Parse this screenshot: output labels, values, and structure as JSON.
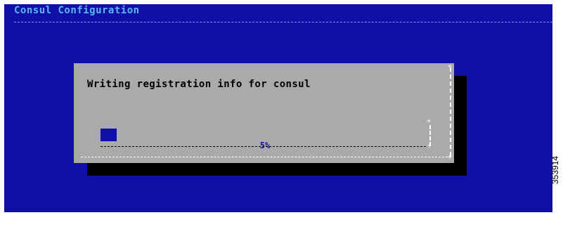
{
  "screen": {
    "title": "Consul Configuration",
    "background_color": "#1010a8",
    "title_color": "#58b8f0"
  },
  "dialog": {
    "message": "Writing registration info for consul",
    "background_color": "#aaaaaa",
    "shadow_color": "#000000",
    "progress": {
      "percent": 5,
      "label": "5%",
      "fill_color": "#1010a8"
    }
  },
  "figure_id": "353914"
}
